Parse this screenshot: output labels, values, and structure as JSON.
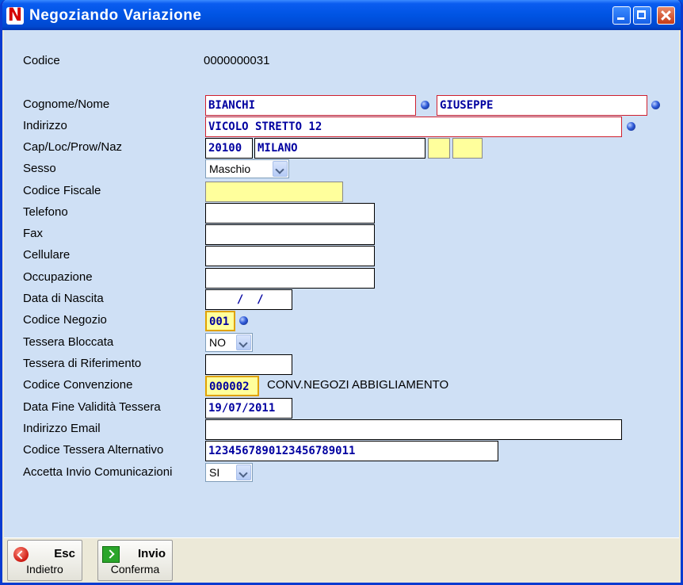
{
  "window": {
    "title": "Negoziando Variazione",
    "logo": "N"
  },
  "form": {
    "codice": {
      "label": "Codice",
      "value": "0000000031"
    },
    "cognome_nome": {
      "label": "Cognome/Nome",
      "cognome": "BIANCHI",
      "nome": "GIUSEPPE"
    },
    "indirizzo": {
      "label": "Indirizzo",
      "value": "VICOLO STRETTO 12"
    },
    "cap_loc": {
      "label": "Cap/Loc/Prow/Naz",
      "cap": "20100",
      "localita": "MILANO",
      "provincia": "",
      "nazione": ""
    },
    "sesso": {
      "label": "Sesso",
      "value": "Maschio"
    },
    "codice_fiscale": {
      "label": "Codice Fiscale",
      "value": ""
    },
    "telefono": {
      "label": "Telefono",
      "value": ""
    },
    "fax": {
      "label": "Fax",
      "value": ""
    },
    "cellulare": {
      "label": "Cellulare",
      "value": ""
    },
    "occupazione": {
      "label": "Occupazione",
      "value": ""
    },
    "data_nascita": {
      "label": "Data di Nascita",
      "value": "  /  /"
    },
    "codice_negozio": {
      "label": "Codice Negozio",
      "value": "001"
    },
    "tessera_bloccata": {
      "label": "Tessera Bloccata",
      "value": "NO"
    },
    "tessera_riferimento": {
      "label": "Tessera di Riferimento",
      "value": ""
    },
    "codice_convenzione": {
      "label": "Codice Convenzione",
      "value": "000002",
      "description": "CONV.NEGOZI ABBIGLIAMENTO"
    },
    "data_fine_validita": {
      "label": "Data Fine Validità Tessera",
      "value": "19/07/2011"
    },
    "email": {
      "label": "Indirizzo Email",
      "value": ""
    },
    "tessera_alternativa": {
      "label": "Codice Tessera Alternativo",
      "value": "12345678901234567890​11"
    },
    "accetta_comunicazioni": {
      "label": "Accetta Invio Comunicazioni",
      "value": "SI"
    }
  },
  "toolbar": {
    "back": {
      "key": "Esc",
      "label": "Indietro",
      "icon": "back-arrow-icon"
    },
    "confirm": {
      "key": "Invio",
      "label": "Conferma",
      "icon": "enter-icon"
    }
  }
}
